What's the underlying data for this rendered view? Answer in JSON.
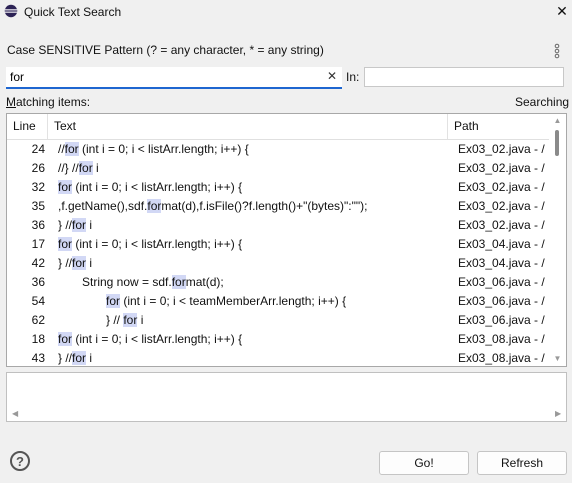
{
  "window": {
    "title": "Quick Text Search",
    "close_glyph": "✕"
  },
  "search": {
    "pattern_label": "Case SENSITIVE Pattern (? = any character, * = any string)",
    "value": "for",
    "clear_glyph": "✕",
    "in_label": "In:",
    "in_value": ""
  },
  "matching": {
    "label_prefix": "M",
    "label_rest": "atching items:",
    "status": "Searching"
  },
  "table": {
    "columns": [
      "Line",
      "Text",
      "Path"
    ],
    "rows": [
      {
        "line": "24",
        "indent": 0,
        "pre": "//",
        "hl": "for",
        "post": " (int i = 0; i < listArr.length; i++) {",
        "path": "Ex03_02.java - /"
      },
      {
        "line": "26",
        "indent": 0,
        "pre": "//} //",
        "hl": "for",
        "post": " i",
        "path": "Ex03_02.java - /"
      },
      {
        "line": "32",
        "indent": 0,
        "pre": "",
        "hl": "for",
        "post": " (int i = 0; i < listArr.length; i++) {",
        "path": "Ex03_02.java - /"
      },
      {
        "line": "35",
        "indent": 0,
        "pre": ",f.getName(),sdf.",
        "hl": "for",
        "post": "mat(d),f.isFile()?f.length()+\"(bytes)\":\"\");",
        "path": "Ex03_02.java - /"
      },
      {
        "line": "36",
        "indent": 0,
        "pre": "} //",
        "hl": "for",
        "post": " i",
        "path": "Ex03_02.java - /"
      },
      {
        "line": "17",
        "indent": 0,
        "pre": "",
        "hl": "for",
        "post": " (int i = 0; i < listArr.length; i++) {",
        "path": "Ex03_04.java - /"
      },
      {
        "line": "42",
        "indent": 0,
        "pre": "} //",
        "hl": "for",
        "post": " i",
        "path": "Ex03_04.java - /"
      },
      {
        "line": "36",
        "indent": 1,
        "pre": "String now = sdf.",
        "hl": "for",
        "post": "mat(d);",
        "path": "Ex03_06.java - /"
      },
      {
        "line": "54",
        "indent": 2,
        "pre": "",
        "hl": "for",
        "post": " (int i = 0; i < teamMemberArr.length; i++) {",
        "path": "Ex03_06.java - /"
      },
      {
        "line": "62",
        "indent": 2,
        "pre": "} // ",
        "hl": "for",
        "post": " i",
        "path": "Ex03_06.java - /"
      },
      {
        "line": "18",
        "indent": 0,
        "pre": "",
        "hl": "for",
        "post": " (int i = 0; i < listArr.length; i++) {",
        "path": "Ex03_08.java - /"
      },
      {
        "line": "43",
        "indent": 0,
        "pre": "} //",
        "hl": "for",
        "post": " i",
        "path": "Ex03_08.java - /"
      }
    ]
  },
  "buttons": {
    "go": "Go!",
    "refresh": "Refresh",
    "help": "?"
  },
  "icons": {
    "app": "eclipse-icon",
    "menu": "vertical-dots-icon",
    "help": "question-icon"
  },
  "colors": {
    "accent": "#1e66d0",
    "highlight": "#d2d8f5"
  }
}
